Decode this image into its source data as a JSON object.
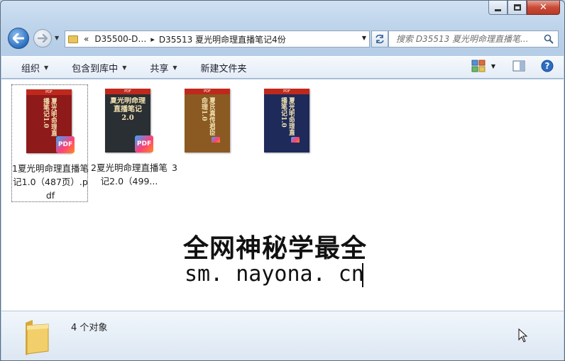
{
  "window": {
    "minimize_label": "_",
    "maximize_label": "□",
    "close_label": "✕"
  },
  "address_bar": {
    "overflow": "«",
    "crumbs": [
      "D35500-D…",
      "D35513 夏光明命理直播笔记4份"
    ],
    "separator": "▸"
  },
  "search": {
    "placeholder": "搜索 D35513 夏光明命理直播笔..."
  },
  "toolbar": {
    "organize": "组织",
    "include_library": "包含到库中",
    "share": "共享",
    "new_folder": "新建文件夹"
  },
  "files": [
    {
      "name": "1夏光明命理直播笔记1.0（487页）.pdf",
      "cover": "夏光明命理直播笔记1.0",
      "cover_color": "#8e1a1a",
      "badge": "PDF",
      "selected": true
    },
    {
      "name": "2夏光明命理直播笔记2.0（499...",
      "cover": "夏光明命理直播笔记2.0",
      "cover_color": "#2a2f33",
      "badge": "PDF",
      "selected": false
    },
    {
      "name": "3",
      "cover": "夏氏真传君臣命理1.0",
      "cover_color": "#8a5a22",
      "badge": "PDF",
      "selected": false
    },
    {
      "name": "",
      "cover": "夏光明命理直播笔记1.0",
      "cover_color": "#1d2a5a",
      "badge": "PDF",
      "selected": false
    }
  ],
  "thumb_header": "PDF",
  "watermark": {
    "title": "全网神秘学最全",
    "url": "sm. nayona. cn"
  },
  "details": {
    "count": "4 个对象"
  }
}
